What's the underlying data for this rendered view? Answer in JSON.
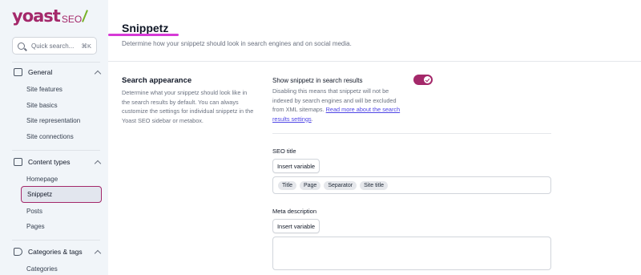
{
  "brand": {
    "name": "yoast",
    "product": "SEO"
  },
  "search": {
    "placeholder": "Quick search...",
    "shortcut": "⌘K"
  },
  "sidebar": {
    "general": {
      "label": "General",
      "icon": "desktop-icon",
      "items": [
        {
          "label": "Site features"
        },
        {
          "label": "Site basics"
        },
        {
          "label": "Site representation"
        },
        {
          "label": "Site connections"
        }
      ]
    },
    "content_types": {
      "label": "Content types",
      "icon": "content-types-icon",
      "items": [
        {
          "label": "Homepage"
        },
        {
          "label": "Snippetz",
          "active": true
        },
        {
          "label": "Posts"
        },
        {
          "label": "Pages"
        }
      ]
    },
    "categories_tags": {
      "label": "Categories & tags",
      "icon": "tag-icon",
      "items": [
        {
          "label": "Categories"
        }
      ]
    }
  },
  "page": {
    "title": "Snippetz",
    "description": "Determine how your snippetz should look in search engines and on social media."
  },
  "section": {
    "title": "Search appearance",
    "description": "Determine what your snippetz should look like in the search results by default. You can always customize the settings for individual snippetz in the Yoast SEO sidebar or metabox."
  },
  "toggle": {
    "label": "Show snippetz in search results",
    "on": true,
    "description": "Disabling this means that snippetz will not be indexed by search engines and will be excluded from XML sitemaps.",
    "link_text": "Read more about the search results settings",
    "link_suffix": "."
  },
  "seo_title": {
    "label": "SEO title",
    "button": "Insert variable",
    "chips": [
      "Title",
      "Page",
      "Separator",
      "Site title"
    ]
  },
  "meta_description": {
    "label": "Meta description",
    "button": "Insert variable"
  },
  "colors": {
    "brand": "#a4286a",
    "accent_underline": "#d63ad6",
    "logo_slash": "#77b227",
    "link": "#4f46e5"
  }
}
